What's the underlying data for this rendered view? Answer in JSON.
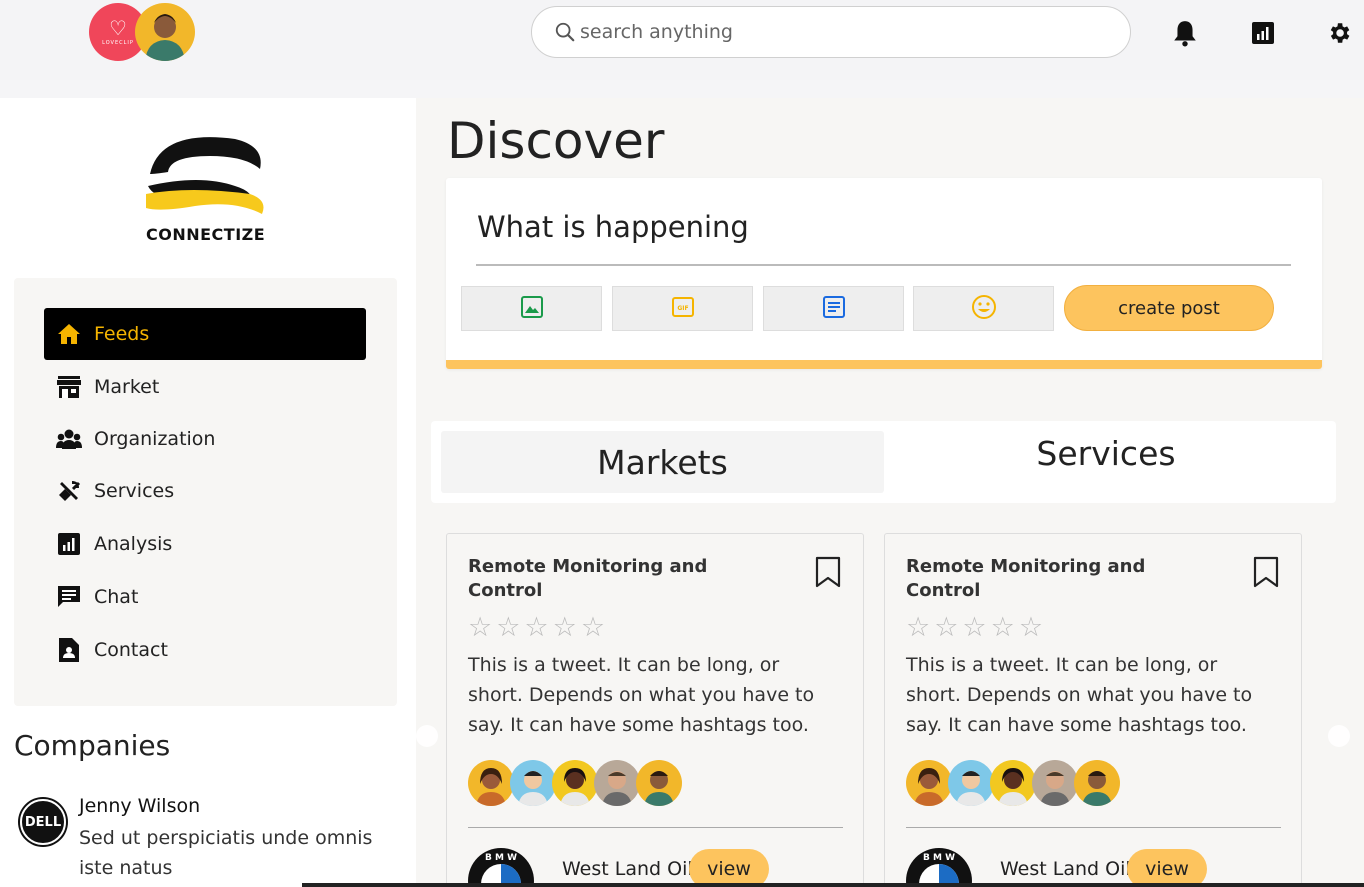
{
  "header": {
    "brand_avatar_label": "LOVECLIP",
    "search": {
      "placeholder": "search anything"
    },
    "icons": [
      "bell-icon",
      "analytics-icon",
      "gear-icon"
    ]
  },
  "sidebar": {
    "logo_text": "CONNECTIZE",
    "nav": [
      {
        "label": "Feeds",
        "icon": "home-icon",
        "active": true
      },
      {
        "label": "Market",
        "icon": "store-icon"
      },
      {
        "label": "Organization",
        "icon": "group-icon"
      },
      {
        "label": "Services",
        "icon": "tools-icon"
      },
      {
        "label": "Analysis",
        "icon": "analytics-icon"
      },
      {
        "label": "Chat",
        "icon": "chat-icon"
      },
      {
        "label": "Contact",
        "icon": "contact-icon"
      }
    ],
    "companies_title": "Companies",
    "company": {
      "logo_text": "DELL",
      "name": "Jenny Wilson",
      "desc": "Sed ut perspiciatis unde omnis iste natus"
    }
  },
  "main": {
    "title": "Discover",
    "composer": {
      "prompt": "What is happening",
      "tools": [
        "image-icon",
        "gif-icon",
        "document-icon",
        "emoji-icon"
      ],
      "create_label": "create post"
    },
    "tabs": {
      "markets": "Markets",
      "services": "Services"
    },
    "cards": [
      {
        "title": "Remote Monitoring and Control",
        "rating": 0,
        "stars": "☆☆☆☆☆",
        "body": "This is a tweet. It can be long, or short. Depends on what you have to say. It can have some hashtags too.",
        "brand_name": "West Land Oil",
        "view_label": "view"
      },
      {
        "title": "Remote Monitoring and Control",
        "rating": 0,
        "stars": "☆☆☆☆☆",
        "body": "This is a tweet. It can be long, or short. Depends on what you have to say. It can have some hashtags too.",
        "brand_name": "West Land Oil",
        "view_label": "view"
      }
    ]
  },
  "colors": {
    "accent": "#fdc45e",
    "active_nav_bg": "#000000",
    "active_nav_text": "#f5b400",
    "brand_pink": "#f0465a"
  }
}
